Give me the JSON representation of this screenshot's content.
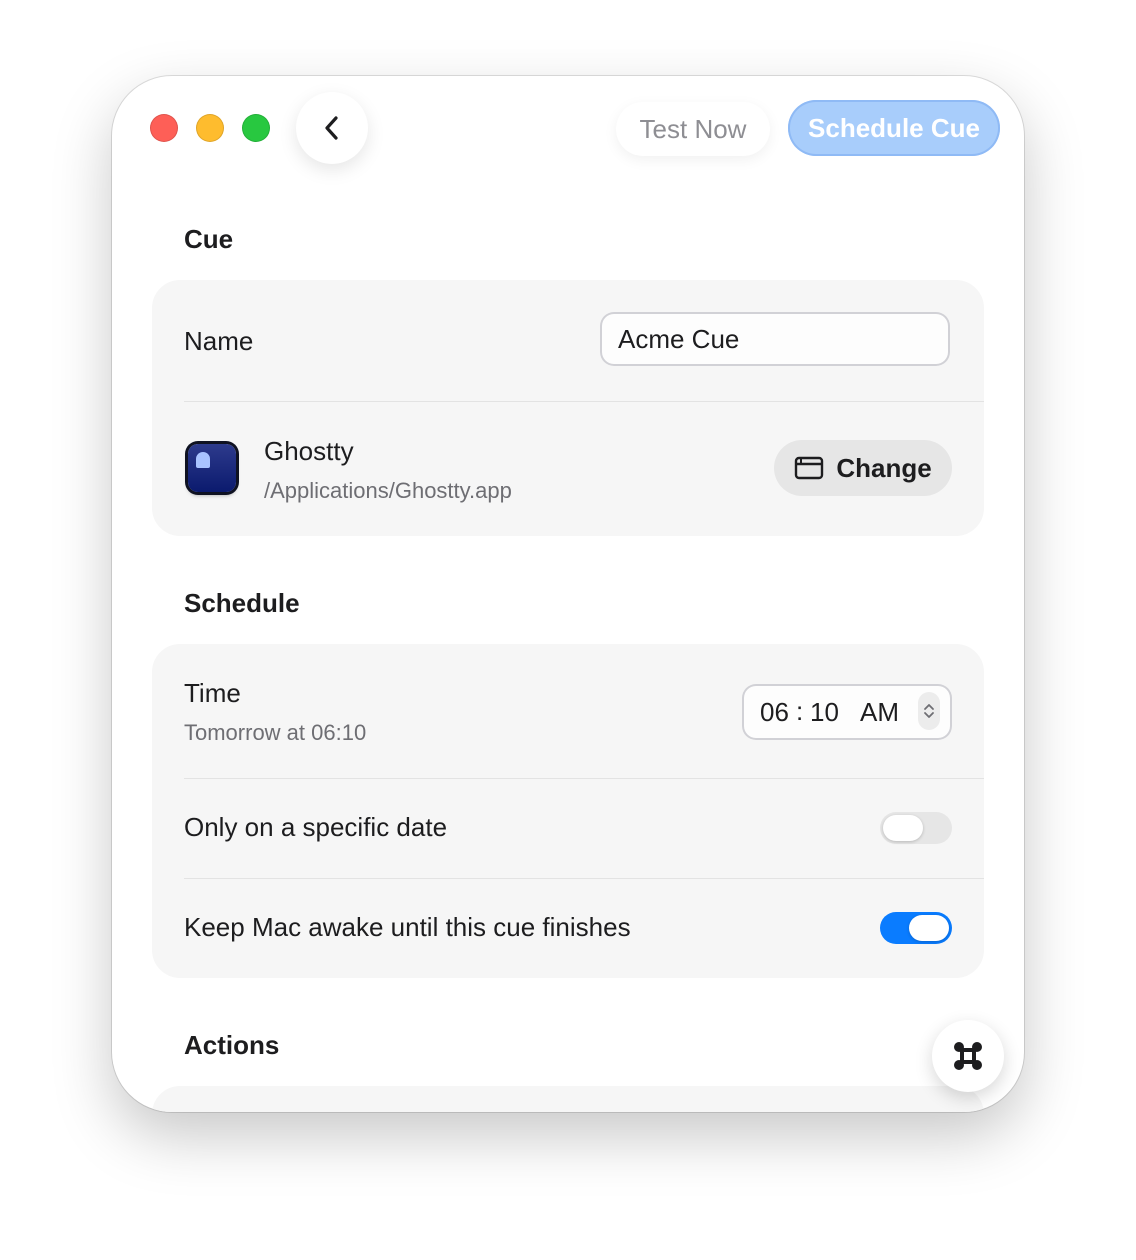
{
  "toolbar": {
    "back_icon": "chevron-left-icon",
    "test_label": "Test Now",
    "schedule_label": "Schedule Cue"
  },
  "cue_section": {
    "title": "Cue",
    "name_label": "Name",
    "name_value": "Acme Cue",
    "app_name": "Ghostty",
    "app_path": "/Applications/Ghostty.app",
    "change_label": "Change",
    "change_icon": "window-icon"
  },
  "schedule_section": {
    "title": "Schedule",
    "time_label": "Time",
    "time_subtitle": "Tomorrow at 06:10",
    "time_hour": "06",
    "time_separator": ":",
    "time_minute": "10",
    "time_period": "AM",
    "specific_date_label": "Only on a specific date",
    "specific_date_enabled": false,
    "keep_awake_label": "Keep Mac awake until this cue finishes",
    "keep_awake_enabled": true
  },
  "actions_section": {
    "title": "Actions"
  },
  "colors": {
    "accent": "#0a7cff",
    "schedule_button": "#a8cdfb",
    "close": "#fe5f57",
    "minimize": "#febc2e",
    "zoom": "#28c840"
  }
}
